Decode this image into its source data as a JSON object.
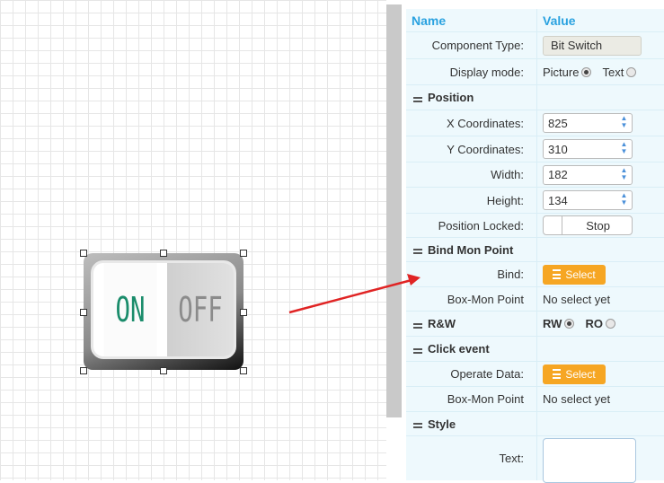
{
  "panel": {
    "header": {
      "name": "Name",
      "value": "Value"
    },
    "component_type": {
      "label": "Component Type:",
      "value": "Bit Switch"
    },
    "display_mode": {
      "label": "Display mode:",
      "option1": "Picture",
      "option2": "Text",
      "selected": "Picture"
    },
    "position": {
      "title": "Position",
      "x": {
        "label": "X Coordinates:",
        "value": "825"
      },
      "y": {
        "label": "Y Coordinates:",
        "value": "310"
      },
      "width": {
        "label": "Width:",
        "value": "182"
      },
      "height": {
        "label": "Height:",
        "value": "134"
      },
      "locked": {
        "label": "Position Locked:",
        "value": "Stop"
      }
    },
    "bind_mon": {
      "title": "Bind Mon Point",
      "bind": {
        "label": "Bind:",
        "button": "Select"
      },
      "box_mon": {
        "label": "Box-Mon Point",
        "value": "No select yet"
      }
    },
    "rw": {
      "title": "R&W",
      "option1": "RW",
      "option2": "RO",
      "selected": "RW"
    },
    "click_event": {
      "title": "Click event",
      "operate": {
        "label": "Operate Data:",
        "button": "Select"
      },
      "box_mon": {
        "label": "Box-Mon Point",
        "value": "No select yet"
      }
    },
    "style": {
      "title": "Style",
      "text": {
        "label": "Text:",
        "value": ""
      }
    }
  },
  "widget": {
    "on_text": "ON",
    "off_text": "OFF"
  },
  "colors": {
    "accent": "#2aa2e0",
    "button": "#f6a623",
    "arrow": "#e02424",
    "on_text": "#1a8c6b"
  }
}
